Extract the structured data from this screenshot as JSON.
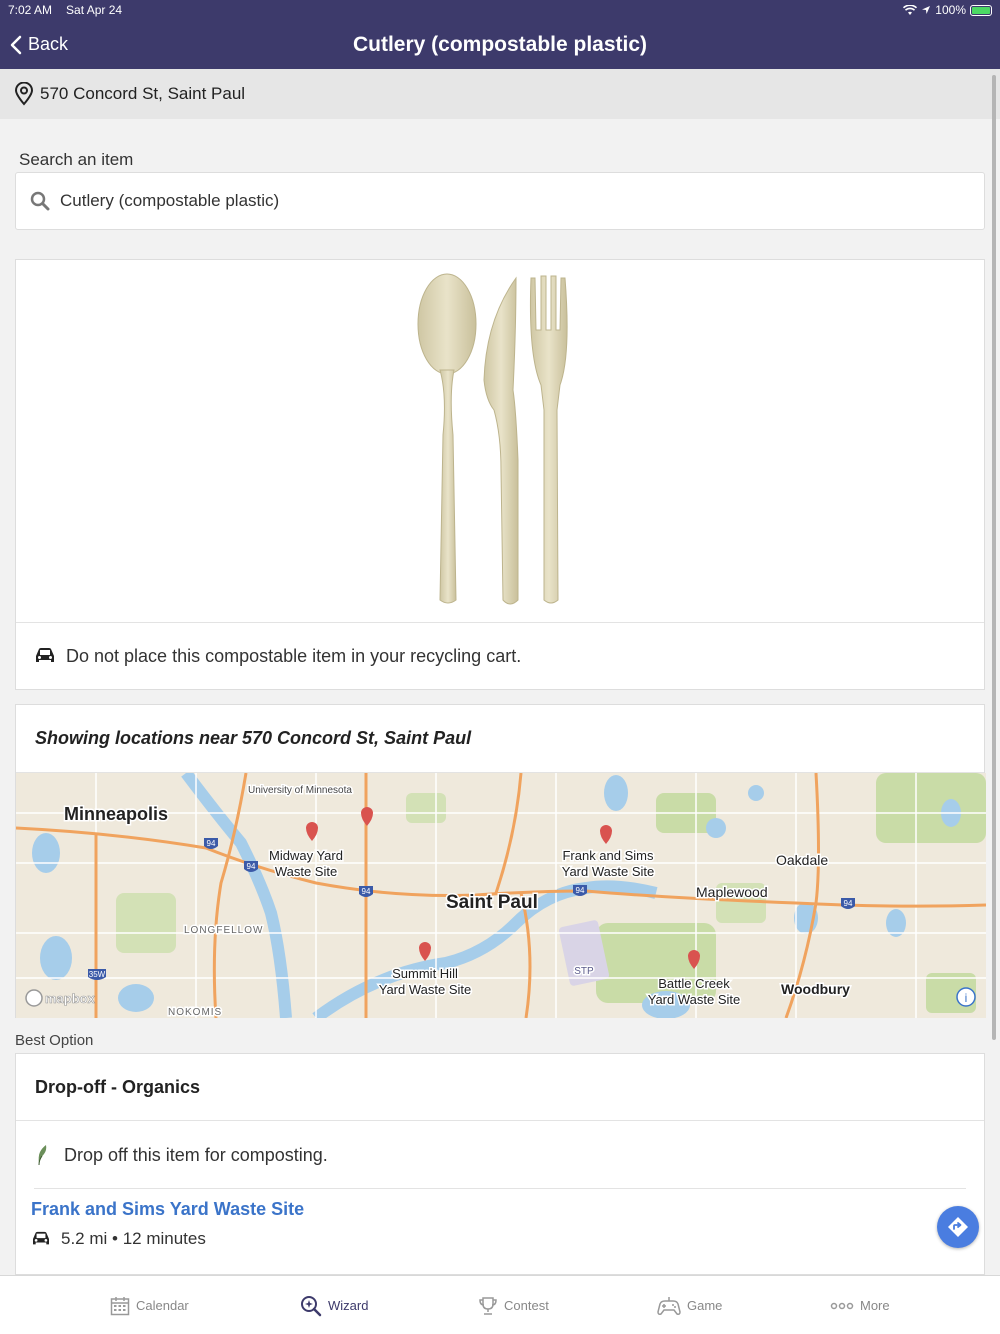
{
  "status": {
    "time": "7:02 AM",
    "date": "Sat Apr 24",
    "battery": "100%"
  },
  "nav": {
    "back_label": "Back",
    "title": "Cutlery (compostable plastic)"
  },
  "address": {
    "text": "570 Concord St, Saint Paul",
    "icon": "location-pin-icon"
  },
  "search": {
    "label": "Search an item",
    "value": "Cutlery (compostable plastic)"
  },
  "item": {
    "image_alt": "compostable spoon, knife and fork",
    "note": "Do not place this compostable item in your recycling cart.",
    "note_icon": "car-icon"
  },
  "locations": {
    "title": "Showing locations near 570 Concord St, Saint Paul",
    "map_labels": {
      "minneapolis": "Minneapolis",
      "university": "University of Minnesota",
      "midway_1": "Midway Yard",
      "midway_2": "Waste Site",
      "frank_1": "Frank and Sims",
      "frank_2": "Yard Waste Site",
      "oakdale": "Oakdale",
      "maplewood": "Maplewood",
      "saint_paul": "Saint Paul",
      "longfellow": "LONGFELLOW",
      "summit_1": "Summit Hill",
      "summit_2": "Yard Waste Site",
      "stp": "STP",
      "battle_1": "Battle Creek",
      "battle_2": "Yard Waste Site",
      "woodbury": "Woodbury",
      "nokomis": "NOKOMIS",
      "mapbox": "mapbox",
      "shield_94": "94",
      "shield_35w": "35W",
      "info": "i"
    }
  },
  "best_option": {
    "label": "Best Option",
    "title": "Drop-off - Organics",
    "note": "Drop off this item for composting.",
    "note_icon": "leaf-icon",
    "site_name": "Frank and Sims Yard Waste Site",
    "site_distance": "5.2 mi • 12 minutes"
  },
  "tabs": [
    {
      "label": "Calendar",
      "icon": "calendar-icon"
    },
    {
      "label": "Wizard",
      "icon": "wizard-search-icon"
    },
    {
      "label": "Contest",
      "icon": "trophy-icon"
    },
    {
      "label": "Game",
      "icon": "game-icon"
    },
    {
      "label": "More",
      "icon": "more-icon"
    }
  ],
  "colors": {
    "header": "#3d3a6b",
    "link": "#3b74c9",
    "direction_button": "#4a7de0",
    "map_pin": "#d9534f"
  }
}
